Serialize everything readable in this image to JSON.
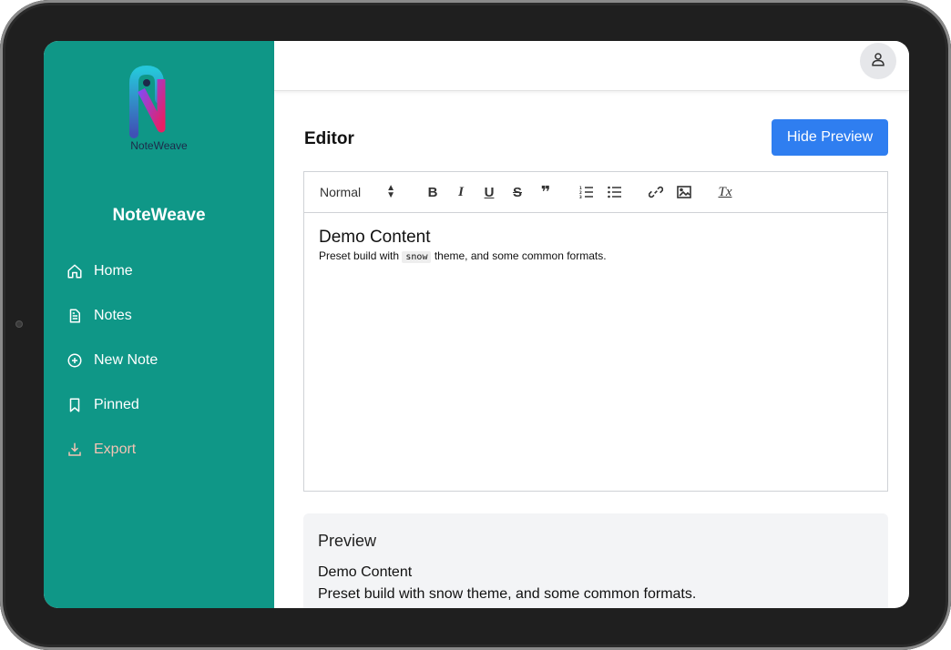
{
  "sidebar": {
    "logo_text": "NoteWeave",
    "brand": "NoteWeave",
    "items": [
      {
        "label": "Home",
        "icon": "home-icon"
      },
      {
        "label": "Notes",
        "icon": "document-icon"
      },
      {
        "label": "New Note",
        "icon": "plus-circle-icon"
      },
      {
        "label": "Pinned",
        "icon": "bookmark-icon"
      },
      {
        "label": "Export",
        "icon": "download-icon"
      }
    ]
  },
  "header": {
    "avatar_icon": "user-icon"
  },
  "main": {
    "title": "Editor",
    "hide_preview_label": "Hide Preview"
  },
  "toolbar": {
    "heading_select": "Normal",
    "bold": "B",
    "italic": "I",
    "underline": "U",
    "strike": "S",
    "quote": "❞",
    "clear_format": "Tx"
  },
  "editor": {
    "heading": "Demo Content",
    "text_before": "Preset build with ",
    "code": "snow",
    "text_after": " theme, and some common formats."
  },
  "preview": {
    "title": "Preview",
    "heading": "Demo Content",
    "text_before": "Preset build with ",
    "code": "snow",
    "text_after": " theme, and some common formats."
  },
  "colors": {
    "sidebar": "#0f9787",
    "primary": "#2f7ef0",
    "export_text": "#f4c3b4"
  }
}
